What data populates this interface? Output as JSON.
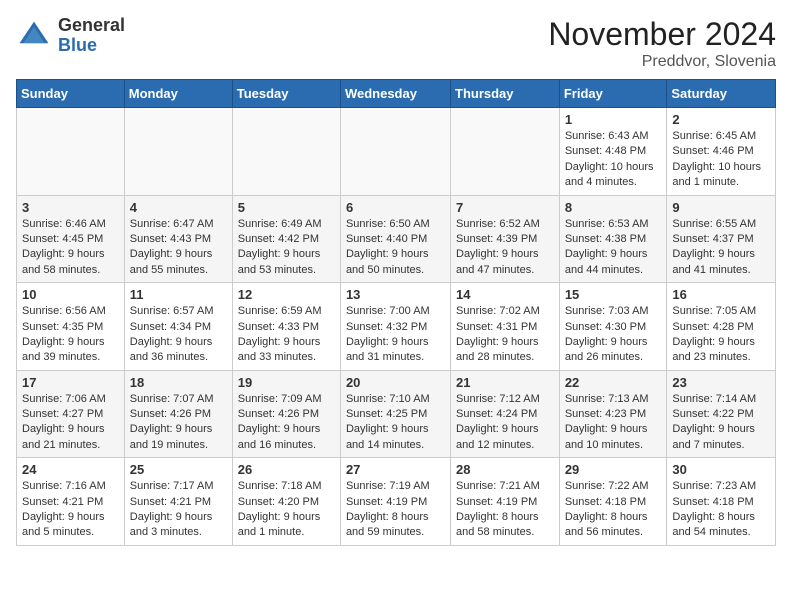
{
  "header": {
    "logo_general": "General",
    "logo_blue": "Blue",
    "month_title": "November 2024",
    "location": "Preddvor, Slovenia"
  },
  "weekdays": [
    "Sunday",
    "Monday",
    "Tuesday",
    "Wednesday",
    "Thursday",
    "Friday",
    "Saturday"
  ],
  "weeks": [
    [
      {
        "day": "",
        "info": ""
      },
      {
        "day": "",
        "info": ""
      },
      {
        "day": "",
        "info": ""
      },
      {
        "day": "",
        "info": ""
      },
      {
        "day": "",
        "info": ""
      },
      {
        "day": "1",
        "info": "Sunrise: 6:43 AM\nSunset: 4:48 PM\nDaylight: 10 hours and 4 minutes."
      },
      {
        "day": "2",
        "info": "Sunrise: 6:45 AM\nSunset: 4:46 PM\nDaylight: 10 hours and 1 minute."
      }
    ],
    [
      {
        "day": "3",
        "info": "Sunrise: 6:46 AM\nSunset: 4:45 PM\nDaylight: 9 hours and 58 minutes."
      },
      {
        "day": "4",
        "info": "Sunrise: 6:47 AM\nSunset: 4:43 PM\nDaylight: 9 hours and 55 minutes."
      },
      {
        "day": "5",
        "info": "Sunrise: 6:49 AM\nSunset: 4:42 PM\nDaylight: 9 hours and 53 minutes."
      },
      {
        "day": "6",
        "info": "Sunrise: 6:50 AM\nSunset: 4:40 PM\nDaylight: 9 hours and 50 minutes."
      },
      {
        "day": "7",
        "info": "Sunrise: 6:52 AM\nSunset: 4:39 PM\nDaylight: 9 hours and 47 minutes."
      },
      {
        "day": "8",
        "info": "Sunrise: 6:53 AM\nSunset: 4:38 PM\nDaylight: 9 hours and 44 minutes."
      },
      {
        "day": "9",
        "info": "Sunrise: 6:55 AM\nSunset: 4:37 PM\nDaylight: 9 hours and 41 minutes."
      }
    ],
    [
      {
        "day": "10",
        "info": "Sunrise: 6:56 AM\nSunset: 4:35 PM\nDaylight: 9 hours and 39 minutes."
      },
      {
        "day": "11",
        "info": "Sunrise: 6:57 AM\nSunset: 4:34 PM\nDaylight: 9 hours and 36 minutes."
      },
      {
        "day": "12",
        "info": "Sunrise: 6:59 AM\nSunset: 4:33 PM\nDaylight: 9 hours and 33 minutes."
      },
      {
        "day": "13",
        "info": "Sunrise: 7:00 AM\nSunset: 4:32 PM\nDaylight: 9 hours and 31 minutes."
      },
      {
        "day": "14",
        "info": "Sunrise: 7:02 AM\nSunset: 4:31 PM\nDaylight: 9 hours and 28 minutes."
      },
      {
        "day": "15",
        "info": "Sunrise: 7:03 AM\nSunset: 4:30 PM\nDaylight: 9 hours and 26 minutes."
      },
      {
        "day": "16",
        "info": "Sunrise: 7:05 AM\nSunset: 4:28 PM\nDaylight: 9 hours and 23 minutes."
      }
    ],
    [
      {
        "day": "17",
        "info": "Sunrise: 7:06 AM\nSunset: 4:27 PM\nDaylight: 9 hours and 21 minutes."
      },
      {
        "day": "18",
        "info": "Sunrise: 7:07 AM\nSunset: 4:26 PM\nDaylight: 9 hours and 19 minutes."
      },
      {
        "day": "19",
        "info": "Sunrise: 7:09 AM\nSunset: 4:26 PM\nDaylight: 9 hours and 16 minutes."
      },
      {
        "day": "20",
        "info": "Sunrise: 7:10 AM\nSunset: 4:25 PM\nDaylight: 9 hours and 14 minutes."
      },
      {
        "day": "21",
        "info": "Sunrise: 7:12 AM\nSunset: 4:24 PM\nDaylight: 9 hours and 12 minutes."
      },
      {
        "day": "22",
        "info": "Sunrise: 7:13 AM\nSunset: 4:23 PM\nDaylight: 9 hours and 10 minutes."
      },
      {
        "day": "23",
        "info": "Sunrise: 7:14 AM\nSunset: 4:22 PM\nDaylight: 9 hours and 7 minutes."
      }
    ],
    [
      {
        "day": "24",
        "info": "Sunrise: 7:16 AM\nSunset: 4:21 PM\nDaylight: 9 hours and 5 minutes."
      },
      {
        "day": "25",
        "info": "Sunrise: 7:17 AM\nSunset: 4:21 PM\nDaylight: 9 hours and 3 minutes."
      },
      {
        "day": "26",
        "info": "Sunrise: 7:18 AM\nSunset: 4:20 PM\nDaylight: 9 hours and 1 minute."
      },
      {
        "day": "27",
        "info": "Sunrise: 7:19 AM\nSunset: 4:19 PM\nDaylight: 8 hours and 59 minutes."
      },
      {
        "day": "28",
        "info": "Sunrise: 7:21 AM\nSunset: 4:19 PM\nDaylight: 8 hours and 58 minutes."
      },
      {
        "day": "29",
        "info": "Sunrise: 7:22 AM\nSunset: 4:18 PM\nDaylight: 8 hours and 56 minutes."
      },
      {
        "day": "30",
        "info": "Sunrise: 7:23 AM\nSunset: 4:18 PM\nDaylight: 8 hours and 54 minutes."
      }
    ]
  ]
}
